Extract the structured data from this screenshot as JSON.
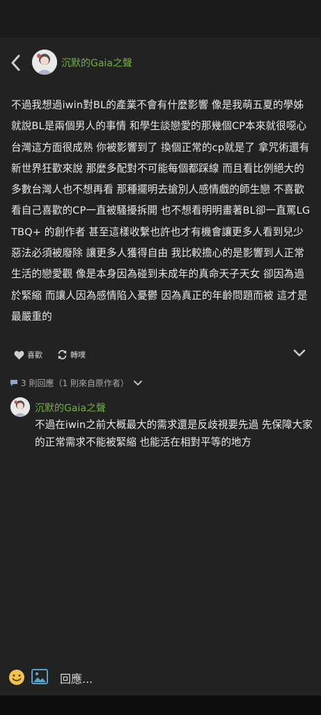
{
  "post": {
    "author": "沉默的Gaia之聲",
    "body": "不過我想過iwin對BL的產業不會有什麼影響 像是我萌五夏的學姊就說BL是兩個男人的事情 和學生談戀愛的那幾個CP本來就很噁心 台灣這方面很成熟 你被影響到了 換個正常的cp就是了 拿咒術還有新世界狂歡來說 那麼多配對不可能每個都踩線 而且看比例絕大的多數台灣人也不想再看 那種擺明去搶別人感情戲的師生戀 不喜歡看自己喜歡的CP一直被騷擾拆開 也不想看明明畫著BL卻一直罵LGTBQ+ 的創作者 甚至這樣收繫也許也才有機會讓更多人看到兒少惡法必須被廢除 讓更多人獲得自由 我比較擔心的是影響到人正常生活的戀愛觀 像是本身因為碰到未成年的真命天子天女 卻因為過於緊縮 而讓人因為感情陷入憂鬱 因為真正的年齡問題而被 這才是最嚴重的",
    "like_label": "喜歡",
    "repost_label": "轉噗"
  },
  "replies": {
    "count_label": "3 則回應（1 則來自原作者）",
    "items": [
      {
        "author": "沉默的Gaia之聲",
        "text": "不過在iwin之前大概最大的需求還是反歧視要先過 先保障大家的正常需求不能被緊縮 也能活在相對平等的地方"
      }
    ]
  },
  "composer": {
    "placeholder": "回應..."
  },
  "colors": {
    "background": "#222222",
    "author": "#6fb33c",
    "text": "#e8e8e8",
    "icon_blue": "#5aa0c8",
    "emoji": "#f2c14e"
  },
  "icons": {
    "back": "chevron-left-icon",
    "like": "heart-icon",
    "repost": "repost-icon",
    "expand": "chevron-down-icon",
    "comments": "speech-bubble-icon",
    "emoji": "emoji-icon",
    "image": "image-icon"
  }
}
